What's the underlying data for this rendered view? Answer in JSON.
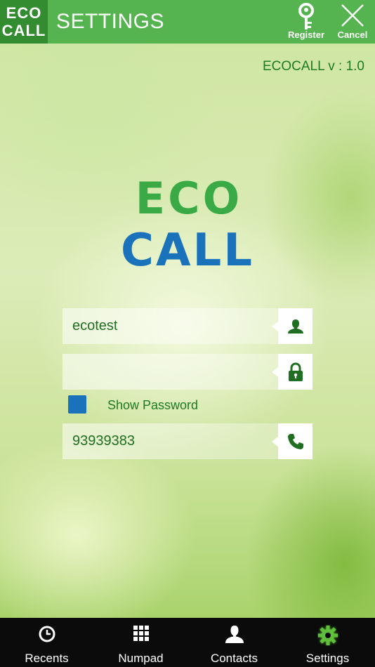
{
  "header": {
    "logo_line1": "ECO",
    "logo_line2": "CALL",
    "title": "SETTINGS",
    "register_label": "Register",
    "cancel_label": "Cancel"
  },
  "version": "ECOCALL v : 1.0",
  "brand": {
    "eco": "ECO",
    "call": "CALL"
  },
  "form": {
    "username_value": "ecotest",
    "password_value": "",
    "show_password_label": "Show Password",
    "show_password_checked": true,
    "phone_value": "93939383"
  },
  "nav": {
    "items": [
      {
        "label": "Recents",
        "icon": "clock-icon"
      },
      {
        "label": "Numpad",
        "icon": "grid-icon"
      },
      {
        "label": "Contacts",
        "icon": "person-icon"
      },
      {
        "label": "Settings",
        "icon": "gear-icon"
      }
    ],
    "active": "Settings"
  },
  "colors": {
    "header_bg": "#55b44f",
    "logo_bg": "#338c2f",
    "brand_green": "#3aaa46",
    "brand_blue": "#1a72bb",
    "text_green": "#1f7a22",
    "nav_bg": "#0b0b0b",
    "checkbox": "#1a72bb"
  }
}
